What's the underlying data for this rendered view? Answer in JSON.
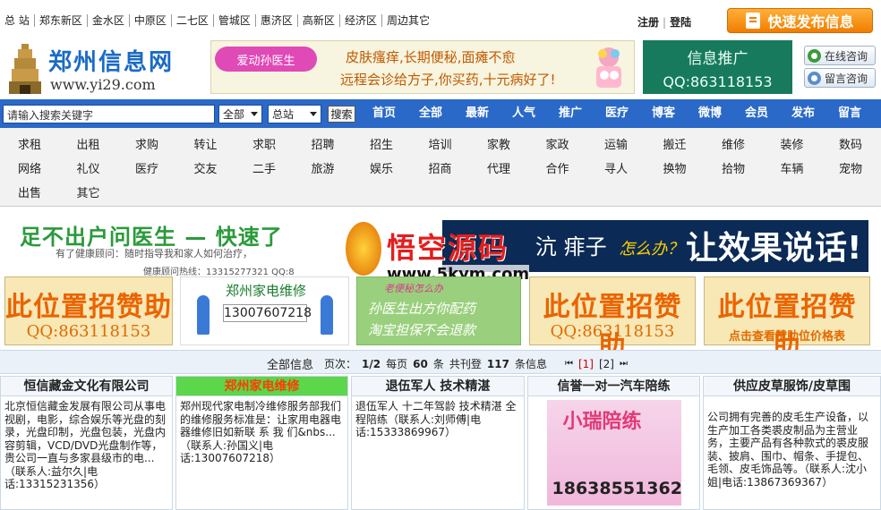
{
  "top": {
    "regions": [
      "总 站",
      "郑东新区",
      "金水区",
      "中原区",
      "二七区",
      "管城区",
      "惠济区",
      "高新区",
      "经济区",
      "周边其它"
    ],
    "register": "注册",
    "login": "登陆",
    "publish_button": "快速发布信息"
  },
  "header": {
    "site_name": "郑州信息网",
    "site_url": "www.yi29.com",
    "ad_badge": "爱动孙医生",
    "ad_line1": "皮肤瘙痒,长期便秘,面瘫不愈",
    "ad_line2": "远程会诊给方子,你买药,十元病好了!",
    "promo_title": "信息推广",
    "promo_qq": "QQ:863118153",
    "online_consult": "在线咨询",
    "message_consult": "留言咨询"
  },
  "nav": {
    "search_placeholder": "请输入搜索关键字",
    "select_category": "全部",
    "select_site": "总站",
    "search_button": "搜索",
    "items": [
      "首页",
      "全部",
      "最新",
      "人气",
      "推广",
      "医疗",
      "博客",
      "微博",
      "会员",
      "发布",
      "留言"
    ]
  },
  "categories": [
    [
      "求租",
      "出租",
      "求购",
      "转让",
      "求职",
      "招聘",
      "招生",
      "培训",
      "家教",
      "家政",
      "运输",
      "搬迁",
      "维修",
      "装修",
      "数码"
    ],
    [
      "网络",
      "礼仪",
      "医疗",
      "交友",
      "二手",
      "旅游",
      "娱乐",
      "招商",
      "代理",
      "合作",
      "寻人",
      "换物",
      "拾物",
      "车辆",
      "宠物"
    ],
    [
      "出售",
      "其它"
    ]
  ],
  "banner": {
    "left_title": "足不出户问医生 — 快速了",
    "left_sub": "有了健康顾问：随时指导我和家人如何治疗，",
    "left_hotline": "健康顾问热线：13315277321 QQ:8",
    "right_text": "沆 痱子",
    "right_small": "怎么办？",
    "right_big": "让效果说话!",
    "watermark_title": "悟空源码",
    "watermark_url": "www.5kym.com"
  },
  "sponsors": {
    "slot_title": "此位置招赞助",
    "slot_qq": "QQ:863118153",
    "slot_link": "点击查看赞助位价格表",
    "repair_title": "郑州家电维修",
    "repair_phone": "13007607218",
    "doctor_head": "老便秘怎么办",
    "doctor_line1": "孙医生出方你配药",
    "doctor_line2": "淘宝担保不会退款"
  },
  "listing": {
    "title": "全部信息",
    "page_label": "页次：",
    "page_value": "1/2",
    "per_page_label": "每页",
    "per_page_value": "60",
    "per_page_unit": "条",
    "total_label": "共刊登",
    "total_value": "117",
    "total_unit": "条信息",
    "page1": "[1]",
    "page2": "[2]"
  },
  "cards": [
    {
      "title": "恒信藏金文化有限公司",
      "body": "北京恒信藏金发展有限公司从事电视剧，电影，综合娱乐等光盘的刻录，光盘印制，光盘包装，光盘内容剪辑，VCD/DVD光盘制作等，贵公司一直与多家县级市的电...（联系人:益尔久|电话:13315231356）"
    },
    {
      "title": "郑州家电维修",
      "body": "郑州现代家电制冷维修服务部我们的维修服务标准是：让家用电器电器维修旧如新联 系 我 们&nbs...（联系人:孙国义|电话:13007607218）"
    },
    {
      "title": "退伍军人  技术精湛",
      "body": "退伍军人 十二年驾龄 技术精湛 全程陪练（联系人:刘师傅|电话:15333869967）"
    },
    {
      "title": "信誉一对一汽车陪练",
      "img_text1": "小瑞陪练",
      "img_text2": "18638551362"
    },
    {
      "title": "供应皮草服饰/皮草围",
      "body": "公司拥有完善的皮毛生产设备，以生产加工各类裘皮制品为主营业务，主要产品有各种款式的裘皮服装、披肩、围巾、帽条、手提包、毛领、皮毛饰品等。（联系人:沈小姐|电话:13867369367）"
    }
  ]
}
